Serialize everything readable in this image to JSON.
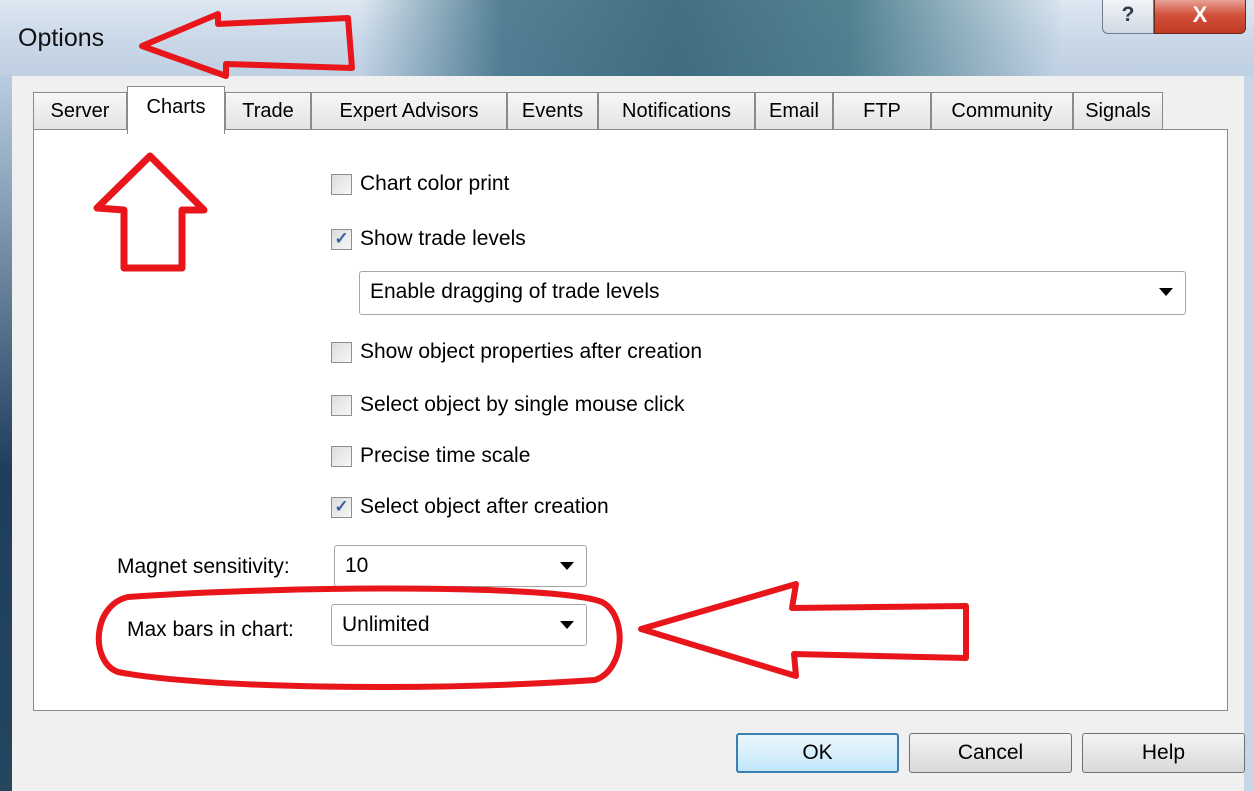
{
  "window": {
    "title": "Options",
    "help_label": "?",
    "close_label": "X"
  },
  "tabs": [
    {
      "label": "Server"
    },
    {
      "label": "Charts"
    },
    {
      "label": "Trade"
    },
    {
      "label": "Expert Advisors"
    },
    {
      "label": "Events"
    },
    {
      "label": "Notifications"
    },
    {
      "label": "Email"
    },
    {
      "label": "FTP"
    },
    {
      "label": "Community"
    },
    {
      "label": "Signals"
    }
  ],
  "active_tab": "Charts",
  "charts": {
    "chart_color_print": {
      "label": "Chart color print",
      "checked": false
    },
    "show_trade_levels": {
      "label": "Show trade levels",
      "checked": true,
      "mark": "✓"
    },
    "trade_levels_mode": {
      "value": "Enable dragging of trade levels"
    },
    "show_object_properties": {
      "label": "Show object properties after creation",
      "checked": false
    },
    "select_single_click": {
      "label": "Select object by single mouse click",
      "checked": false
    },
    "precise_time_scale": {
      "label": "Precise time scale",
      "checked": false
    },
    "select_after_creation": {
      "label": "Select object after creation",
      "checked": true,
      "mark": "✓"
    },
    "magnet_sensitivity": {
      "label": "Magnet sensitivity:",
      "value": "10"
    },
    "max_bars": {
      "label": "Max bars in chart:",
      "value": "Unlimited"
    }
  },
  "buttons": {
    "ok": "OK",
    "cancel": "Cancel",
    "help": "Help"
  },
  "annotation_color": "#e8151b"
}
